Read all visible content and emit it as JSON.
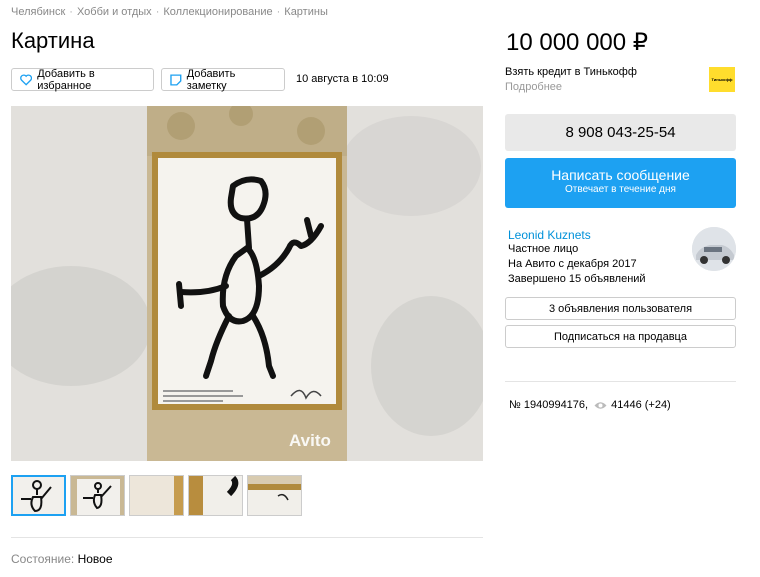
{
  "breadcrumbs": [
    "Челябинск",
    "Хобби и отдых",
    "Коллекционирование",
    "Картины"
  ],
  "title": "Картина",
  "price": "10 000 000 ₽",
  "actions": {
    "favorite_label": "Добавить в избранное",
    "note_label": "Добавить заметку",
    "date": "10 августа в 10:09"
  },
  "credit": {
    "label": "Взять кредит в Тинькофф",
    "more": "Подробнее",
    "logo_text": "Тинькофф"
  },
  "photo": {
    "watermark": "Avito"
  },
  "thumbnails_count": 5,
  "condition": {
    "label": "Состояние:",
    "value": "Новое"
  },
  "contact": {
    "phone": "8 908 043-25-54",
    "message_label": "Написать сообщение",
    "message_sub": "Отвечает в течение дня"
  },
  "seller": {
    "name": "Leonid Kuznets",
    "type": "Частное лицо",
    "since": "На Авито с декабря 2017",
    "completed": "Завершено 15 объявлений",
    "listings_button": "3 объявления пользователя",
    "subscribe_button": "Подписаться на продавца"
  },
  "stats": {
    "item_number": "№ 1940994176,",
    "views": "41446 (+24)"
  },
  "colors": {
    "accent_blue": "#1da1f2",
    "link_blue": "#0091d9",
    "tinkoff_yellow": "#ffdd2d"
  }
}
